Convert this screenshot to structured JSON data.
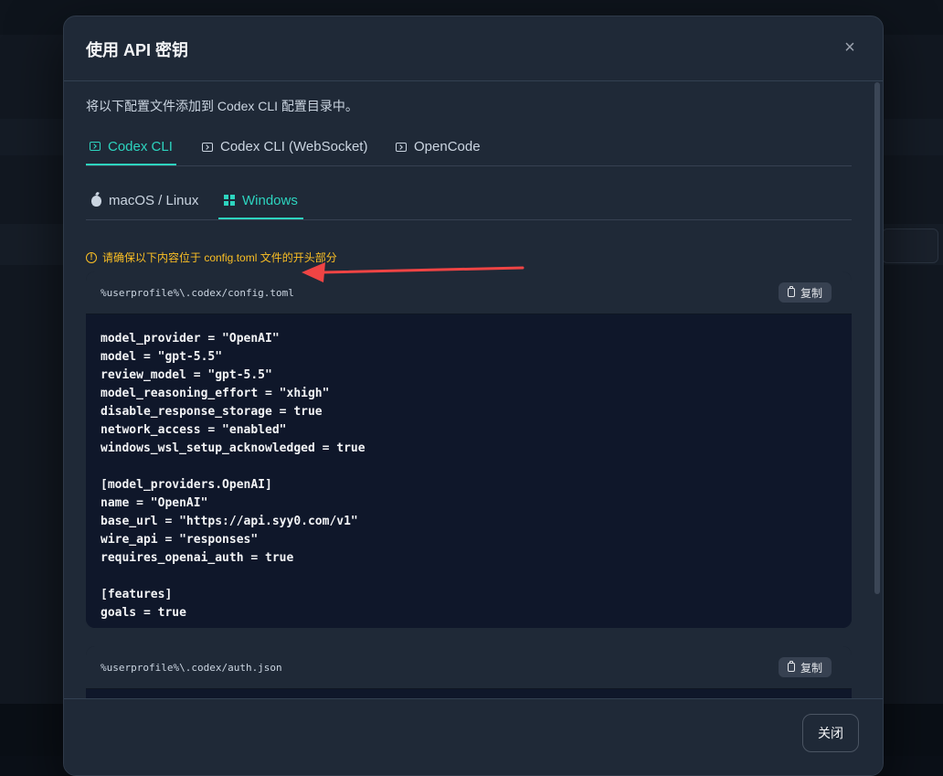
{
  "modal": {
    "title": "使用 API 密钥",
    "intro": "将以下配置文件添加到 Codex CLI 配置目录中。",
    "close_button_label": "关闭"
  },
  "tabs": [
    {
      "label": "Codex CLI",
      "active": true
    },
    {
      "label": "Codex CLI (WebSocket)",
      "active": false
    },
    {
      "label": "OpenCode",
      "active": false
    }
  ],
  "os_tabs": [
    {
      "label": "macOS / Linux",
      "active": false
    },
    {
      "label": "Windows",
      "active": true
    }
  ],
  "warning": "请确保以下内容位于 config.toml 文件的开头部分",
  "files": [
    {
      "path": "%userprofile%\\.codex/config.toml",
      "copy_label": "复制",
      "lines": [
        "model_provider = \"OpenAI\"",
        "model = \"gpt-5.5\"",
        "review_model = \"gpt-5.5\"",
        "model_reasoning_effort = \"xhigh\"",
        "disable_response_storage = true",
        "network_access = \"enabled\"",
        "windows_wsl_setup_acknowledged = true",
        "",
        "[model_providers.OpenAI]",
        "name = \"OpenAI\"",
        "base_url = \"https://api.syy0.com/v1\"",
        "wire_api = \"responses\"",
        "requires_openai_auth = true",
        "",
        "[features]",
        "goals = true"
      ]
    },
    {
      "path": "%userprofile%\\.codex/auth.json",
      "copy_label": "复制",
      "lines": [
        "{"
      ]
    }
  ],
  "colors": {
    "accent": "#2dd4bf",
    "warning": "#fbbf24",
    "annotation_arrow": "#ef4444"
  }
}
